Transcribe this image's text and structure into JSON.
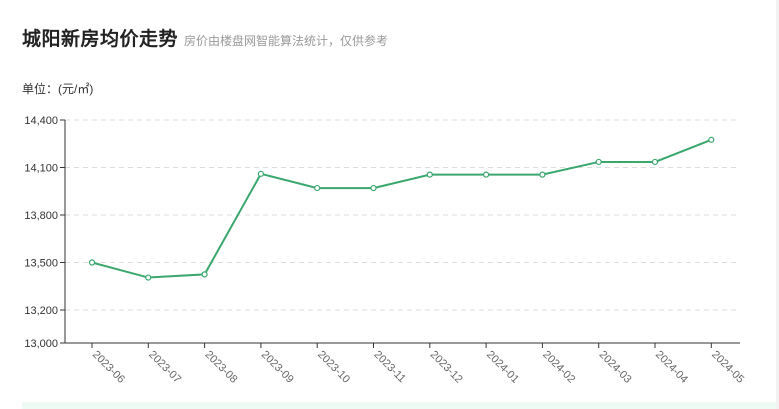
{
  "header": {
    "title": "城阳新房均价走势",
    "subtitle": "房价由楼盘网智能算法统计，仅供参考"
  },
  "unit_label": "单位：(元/㎡)",
  "colors": {
    "line": "#3aa76d",
    "grid": "#dddddd",
    "axis": "#333333",
    "tick_text": "#666666"
  },
  "chart_data": {
    "type": "line",
    "title": "城阳新房均价走势",
    "ylabel": "单位：(元/㎡)",
    "xlabel": "",
    "categories": [
      "2023-06",
      "2023-07",
      "2023-08",
      "2023-09",
      "2023-10",
      "2023-11",
      "2023-12",
      "2024-01",
      "2024-02",
      "2024-03",
      "2024-04",
      "2024-05"
    ],
    "series": [
      {
        "values": [
          13500,
          13405,
          13425,
          14060,
          13970,
          13970,
          14055,
          14055,
          14055,
          14135,
          14135,
          14275
        ]
      }
    ],
    "y_ticks": [
      13000,
      13200,
      13500,
      13800,
      14100,
      14400
    ],
    "ylim": [
      13000,
      14400
    ],
    "grid": true
  }
}
